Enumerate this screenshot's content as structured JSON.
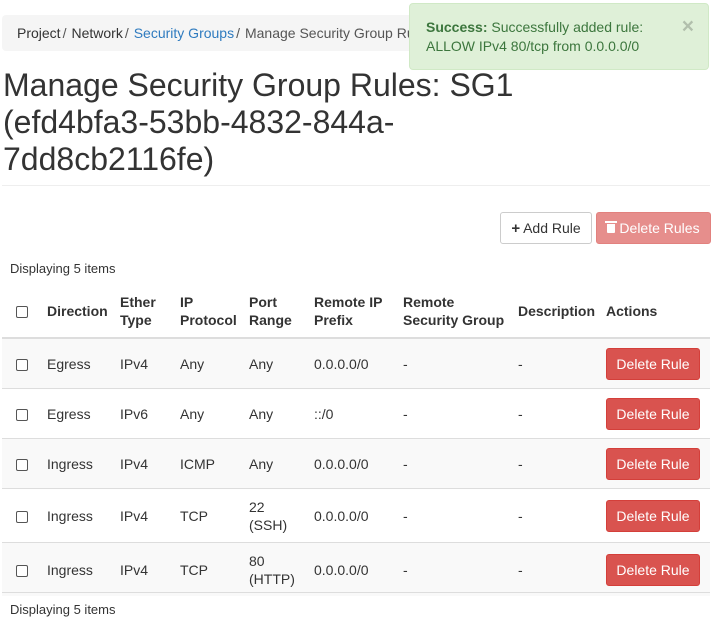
{
  "breadcrumb": {
    "project": "Project",
    "network": "Network",
    "security_groups": "Security Groups",
    "current": "Manage Security Group Rules"
  },
  "alert": {
    "strong": "Success:",
    "message": "Successfully added rule: ALLOW IPv4 80/tcp from 0.0.0.0/0",
    "close": "×"
  },
  "page": {
    "title": "Manage Security Group Rules: SG1 (efd4bfa3-53bb-4832-844a-7dd8cb2116fe)"
  },
  "actions": {
    "add_rule": "Add Rule",
    "delete_rules": "Delete Rules"
  },
  "count_text": "Displaying 5 items",
  "table": {
    "headers": {
      "direction": "Direction",
      "ether_type": "Ether Type",
      "ip_protocol": "IP Protocol",
      "port_range": "Port Range",
      "remote_ip_prefix": "Remote IP Prefix",
      "remote_sg": "Remote Security Group",
      "description": "Description",
      "actions": "Actions"
    },
    "rows": [
      {
        "direction": "Egress",
        "ether_type": "IPv4",
        "ip_protocol": "Any",
        "port_range": "Any",
        "remote_ip_prefix": "0.0.0.0/0",
        "remote_sg": "-",
        "description": "-",
        "action": "Delete Rule"
      },
      {
        "direction": "Egress",
        "ether_type": "IPv6",
        "ip_protocol": "Any",
        "port_range": "Any",
        "remote_ip_prefix": "::/0",
        "remote_sg": "-",
        "description": "-",
        "action": "Delete Rule"
      },
      {
        "direction": "Ingress",
        "ether_type": "IPv4",
        "ip_protocol": "ICMP",
        "port_range": "Any",
        "remote_ip_prefix": "0.0.0.0/0",
        "remote_sg": "-",
        "description": "-",
        "action": "Delete Rule"
      },
      {
        "direction": "Ingress",
        "ether_type": "IPv4",
        "ip_protocol": "TCP",
        "port_range": "22 (SSH)",
        "remote_ip_prefix": "0.0.0.0/0",
        "remote_sg": "-",
        "description": "-",
        "action": "Delete Rule"
      },
      {
        "direction": "Ingress",
        "ether_type": "IPv4",
        "ip_protocol": "TCP",
        "port_range": "80 (HTTP)",
        "remote_ip_prefix": "0.0.0.0/0",
        "remote_sg": "-",
        "description": "-",
        "action": "Delete Rule"
      }
    ]
  },
  "colors": {
    "link": "#2f7bbf",
    "danger": "#d9534f",
    "success_bg": "#dff0d8",
    "success_text": "#3c763d"
  }
}
